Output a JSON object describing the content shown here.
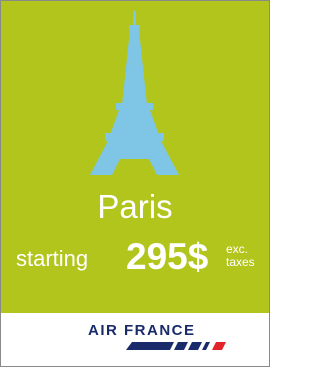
{
  "ad": {
    "city": "Paris",
    "price_prefix": "starting",
    "price": "295$",
    "price_note_line1": "exc.",
    "price_note_line2": "taxes",
    "brand": "AIR FRANCE",
    "image_icon": "eiffel-tower-icon",
    "logo_icon": "air-france-stripes-icon",
    "colors": {
      "background": "#b2c51c",
      "tower": "#7ec5e6",
      "text": "#ffffff",
      "brand_navy": "#1a2b6b",
      "brand_red": "#e3232a"
    }
  }
}
